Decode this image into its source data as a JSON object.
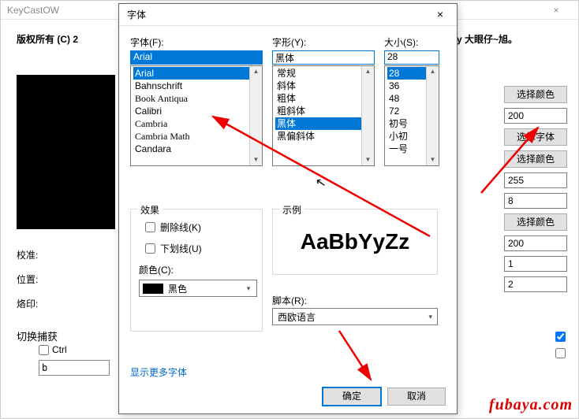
{
  "parent": {
    "title": "KeyCastOW",
    "close": "×",
    "copyright_left": "版权所有 (C) 2",
    "copyright_right": "y 大眼仔~旭。",
    "labels": {
      "calibrate": "校准:",
      "position": "位置:",
      "brand": "烙印:",
      "switch_capture": "切换捕获"
    },
    "ctrl_label": "Ctrl",
    "b_value": "b"
  },
  "right": {
    "btn_color1": "选择颜色",
    "val1": "200",
    "btn_font": "选择字体",
    "btn_color2": "选择颜色",
    "val2": "255",
    "val3": "8",
    "btn_color3": "选择颜色",
    "val4": "200",
    "val5": "1",
    "val6": "2"
  },
  "dialog": {
    "title": "字体",
    "close": "×",
    "font_label": "字体(F):",
    "font_value": "Arial",
    "font_items": [
      "Arial",
      "Bahnschrift",
      "Book Antiqua",
      "Calibri",
      "Cambria",
      "Cambria Math",
      "Candara"
    ],
    "style_label": "字形(Y):",
    "style_value": "黑体",
    "style_items": [
      "常规",
      "斜体",
      "粗体",
      "粗斜体",
      "黑体",
      "黑偏斜体"
    ],
    "size_label": "大小(S):",
    "size_value": "28",
    "size_items": [
      "28",
      "36",
      "48",
      "72",
      "初号",
      "小初",
      "一号"
    ],
    "effects_legend": "效果",
    "strike_label": "删除线(K)",
    "underline_label": "下划线(U)",
    "color_label": "颜色(C):",
    "color_name": "黑色",
    "sample_legend": "示例",
    "sample_text": "AaBbYyZz",
    "script_label": "脚本(R):",
    "script_value": "西欧语言",
    "more_fonts": "显示更多字体",
    "ok": "确定",
    "cancel": "取消"
  },
  "watermark": "fubaya.com"
}
